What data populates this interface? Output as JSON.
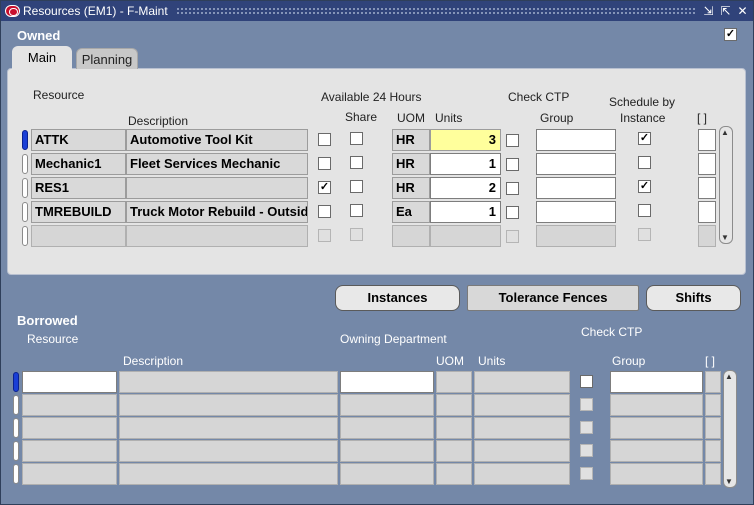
{
  "window": {
    "title": "Resources (EM1) - F-Maint",
    "controls": [
      "minimize-icon",
      "maximize-icon",
      "close-icon"
    ]
  },
  "owned": {
    "section_label": "Owned",
    "tabs": [
      {
        "label": "Main",
        "active": true
      },
      {
        "label": "Planning",
        "active": false
      }
    ],
    "headers": {
      "resource": "Resource",
      "description": "Description",
      "available_24": "Available 24 Hours",
      "share": "Share",
      "uom": "UOM",
      "units": "Units",
      "check_ctp": "Check CTP",
      "group": "Group",
      "schedule_by": "Schedule by",
      "instance": "Instance",
      "flex": "[ ]"
    },
    "rows": [
      {
        "resource": "ATTK",
        "description": "Automotive Tool Kit",
        "available24": false,
        "share": false,
        "uom": "HR",
        "units": "3",
        "check_ctp": false,
        "group": "",
        "schedule_by_instance": true
      },
      {
        "resource": "Mechanic1",
        "description": "Fleet Services Mechanic",
        "available24": false,
        "share": false,
        "uom": "HR",
        "units": "1",
        "check_ctp": false,
        "group": "",
        "schedule_by_instance": false
      },
      {
        "resource": "RES1",
        "description": "",
        "available24": true,
        "share": false,
        "uom": "HR",
        "units": "2",
        "check_ctp": false,
        "group": "",
        "schedule_by_instance": true
      },
      {
        "resource": "TMREBUILD",
        "description": "Truck Motor Rebuild - Outsid",
        "available24": false,
        "share": false,
        "uom": "Ea",
        "units": "1",
        "check_ctp": false,
        "group": "",
        "schedule_by_instance": false
      },
      {
        "resource": "",
        "description": "",
        "available24": false,
        "share": false,
        "uom": "",
        "units": "",
        "check_ctp": false,
        "group": "",
        "schedule_by_instance": false
      }
    ]
  },
  "buttons": {
    "instances": "Instances",
    "tolerance_fences": "Tolerance Fences",
    "shifts": "Shifts"
  },
  "borrowed": {
    "section_label": "Borrowed",
    "headers": {
      "resource": "Resource",
      "description": "Description",
      "owning_department": "Owning Department",
      "uom": "UOM",
      "units": "Units",
      "check_ctp": "Check CTP",
      "group": "Group",
      "flex": "[ ]"
    },
    "row_count": 5
  },
  "colors": {
    "title_bar": "#30437a",
    "background": "#7488a8",
    "units_highlight": "#ffff9c",
    "selected_indicator": "#1a3fd6"
  }
}
